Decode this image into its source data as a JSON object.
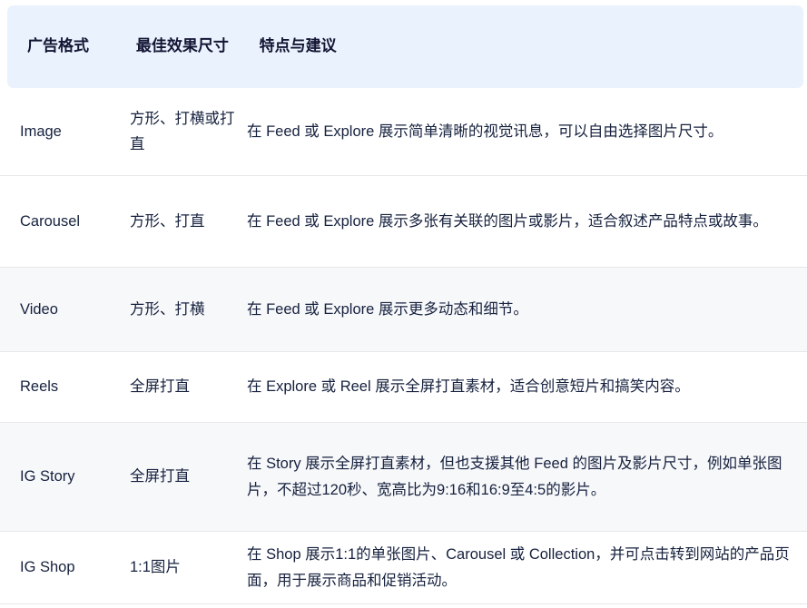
{
  "table": {
    "name": "instagram-ad-format-table",
    "headers": [
      "广告格式",
      "最佳效果尺寸",
      "特点与建议"
    ],
    "accent_header_bg": "#eaf2fd",
    "stripe_bg": "#f7f8fa",
    "header_text_color": "#131533",
    "body_text_color": "#16213e",
    "separator_color": "#e7e7e9",
    "rows": [
      {
        "format": "Image",
        "size": "方形、打横或打直",
        "notes": "在 Feed 或 Explore 展示简单清晰的视觉讯息，可以自由选择图片尺寸。",
        "striped": false
      },
      {
        "format": "Carousel",
        "size": "方形、打直",
        "notes": "在 Feed  或 Explore 展示多张有关联的图片或影片，适合叙述产品特点或故事。",
        "striped": false
      },
      {
        "format": "Video",
        "size": "方形、打横",
        "notes": "在 Feed  或 Explore  展示更多动态和细节。",
        "striped": true
      },
      {
        "format": "Reels",
        "size": "全屏打直",
        "notes": "在 Explore 或 Reel 展示全屏打直素材，适合创意短片和搞笑内容。",
        "striped": false
      },
      {
        "format": "IG Story",
        "size": "全屏打直",
        "notes": "在 Story 展示全屏打直素材，但也支援其他 Feed 的图片及影片尺寸，例如单张图片，不超过120秒、宽高比为9:16和16:9至4:5的影片。",
        "striped": true
      },
      {
        "format": "IG Shop",
        "size": "1:1图片",
        "notes": "在 Shop 展示1:1的单张图片、Carousel 或 Collection，并可点击转到网站的产品页面，用于展示商品和促销活动。",
        "striped": false
      }
    ]
  }
}
